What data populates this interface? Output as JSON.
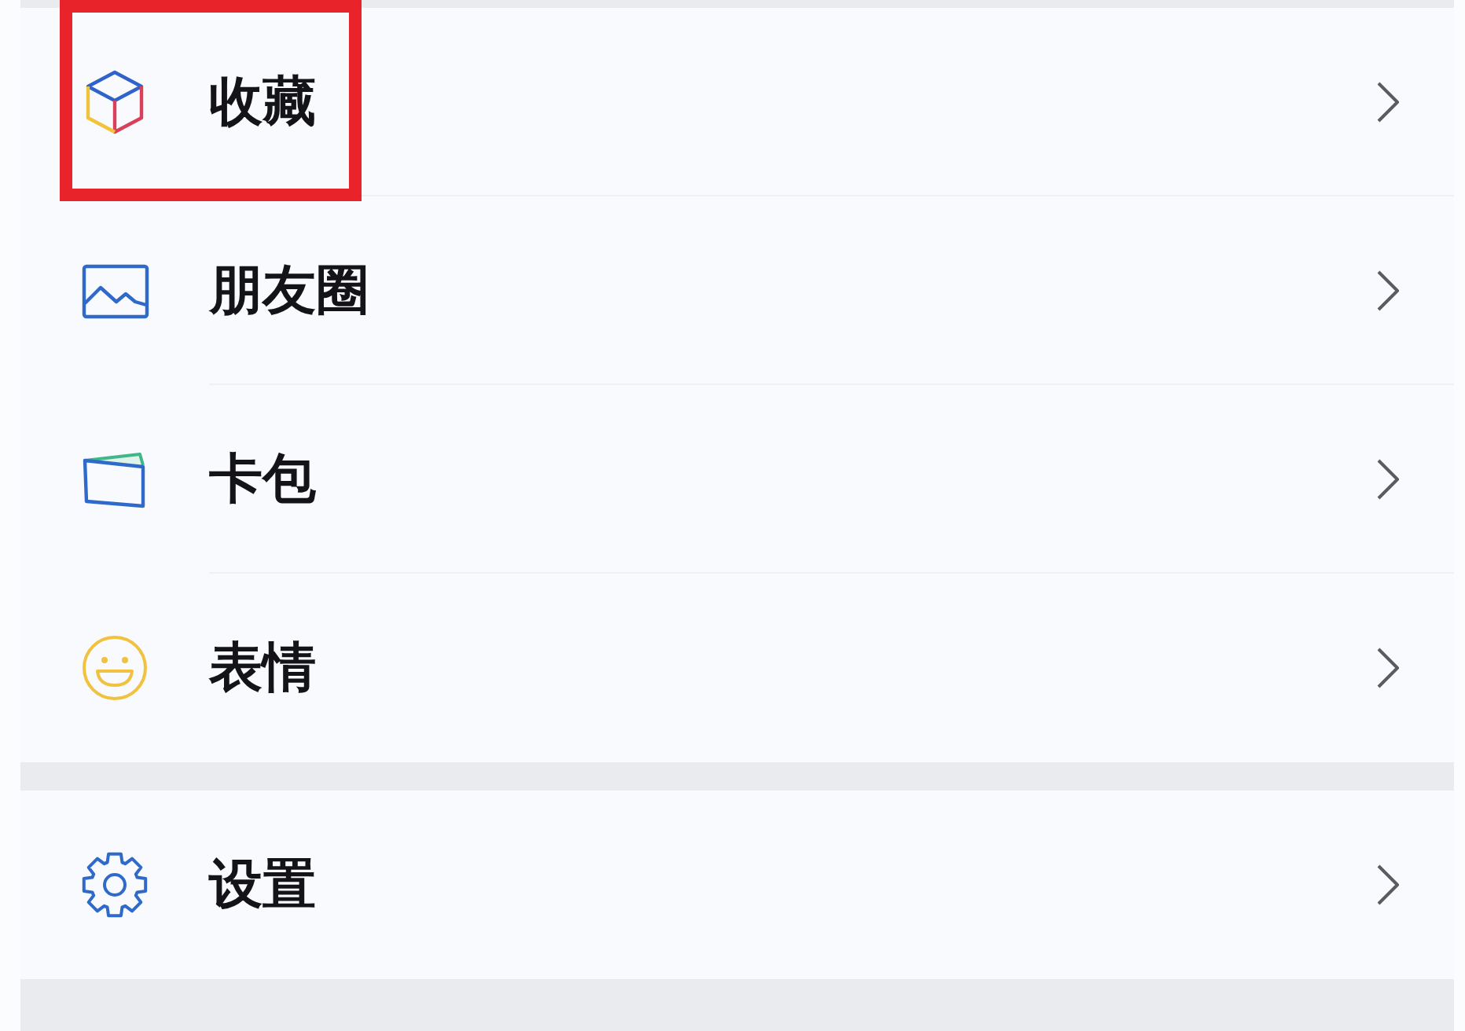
{
  "groups": [
    {
      "items": [
        {
          "label": "收藏",
          "highlighted": true
        },
        {
          "label": "朋友圈",
          "highlighted": false
        },
        {
          "label": "卡包",
          "highlighted": false
        },
        {
          "label": "表情",
          "highlighted": false
        }
      ]
    },
    {
      "items": [
        {
          "label": "设置",
          "highlighted": false
        }
      ]
    }
  ]
}
